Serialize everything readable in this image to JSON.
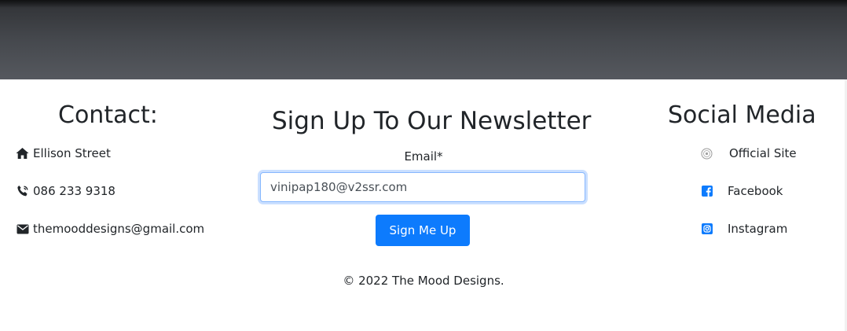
{
  "contact": {
    "title": "Contact:",
    "items": [
      {
        "icon": "home-icon",
        "text": "Ellison Street"
      },
      {
        "icon": "phone-icon",
        "text": "086 233 9318"
      },
      {
        "icon": "envelope-icon",
        "text": "themooddesigns@gmail.com"
      }
    ]
  },
  "newsletter": {
    "title": "Sign Up To Our Newsletter",
    "email_label": "Email*",
    "email_value": "vinipap180@v2ssr.com",
    "button_label": "Sign Me Up"
  },
  "social": {
    "title": "Social Media",
    "items": [
      {
        "icon": "official-site-icon",
        "text": "Official Site"
      },
      {
        "icon": "facebook-icon",
        "text": "Facebook"
      },
      {
        "icon": "instagram-icon",
        "text": "Instagram"
      }
    ]
  },
  "footer": {
    "copyright": "© 2022 The Mood Designs."
  },
  "colors": {
    "accent": "#0d7bfd",
    "text": "#212529",
    "hero_dark": "#2c2e32"
  }
}
